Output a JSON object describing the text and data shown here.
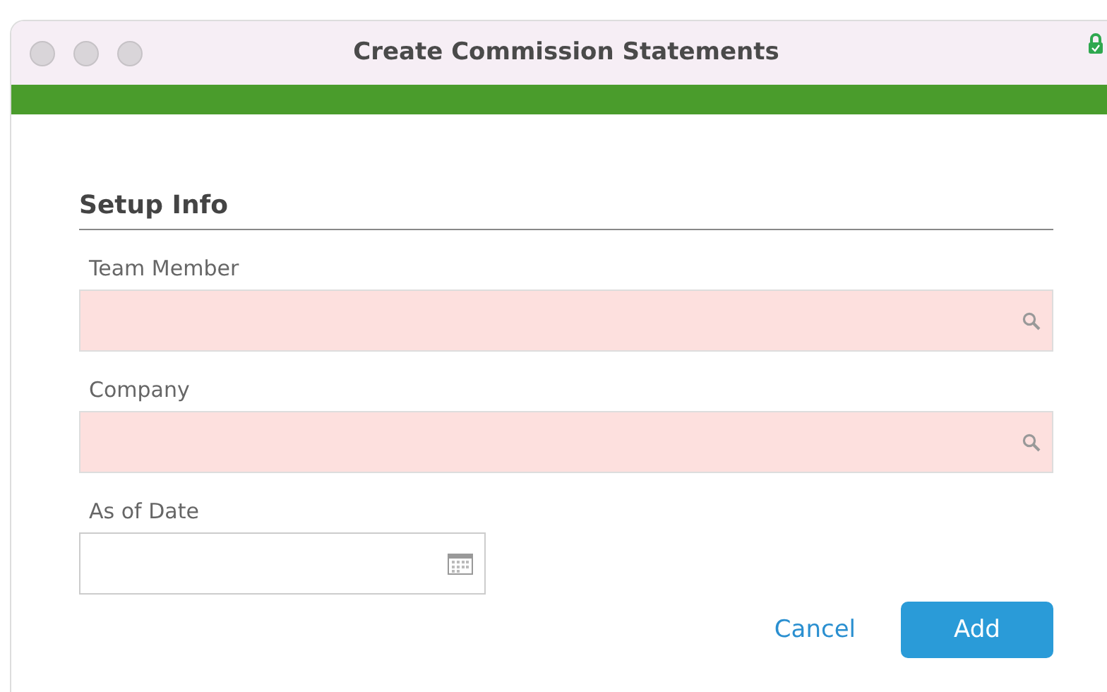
{
  "window": {
    "title": "Create Commission Statements"
  },
  "section": {
    "title": "Setup Info"
  },
  "fields": [
    {
      "label": "Team Member",
      "kind": "lookup",
      "required": true
    },
    {
      "label": "Company",
      "kind": "lookup",
      "required": true
    },
    {
      "label": "As of Date",
      "kind": "date",
      "required": false
    }
  ],
  "buttons": [
    {
      "label": "Cancel",
      "kind": "link"
    },
    {
      "label": "Add",
      "kind": "primary"
    }
  ]
}
